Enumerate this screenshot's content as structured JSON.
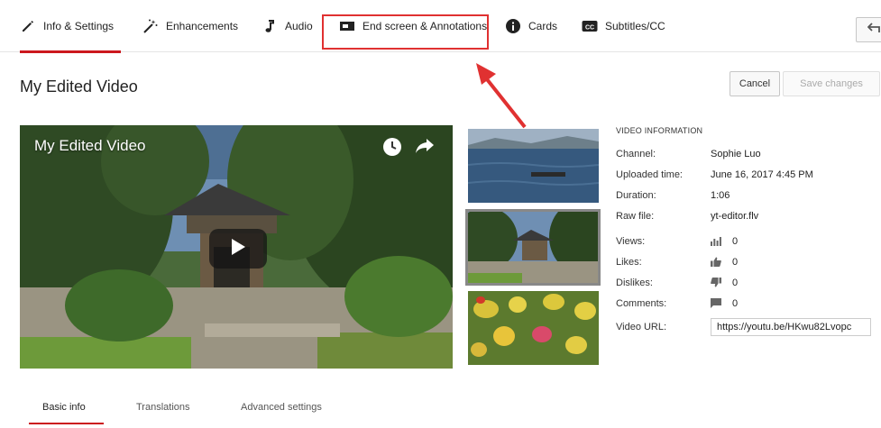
{
  "tabs": [
    {
      "label": "Info & Settings",
      "icon": "pencil-icon",
      "active": true
    },
    {
      "label": "Enhancements",
      "icon": "magic-wand-icon",
      "active": false
    },
    {
      "label": "Audio",
      "icon": "music-note-icon",
      "active": false
    },
    {
      "label": "End screen & Annotations",
      "icon": "end-screen-icon",
      "active": false
    },
    {
      "label": "Cards",
      "icon": "info-circle-icon",
      "active": false
    },
    {
      "label": "Subtitles/CC",
      "icon": "cc-icon",
      "active": false
    }
  ],
  "page": {
    "title": "My Edited Video"
  },
  "actions": {
    "cancel_label": "Cancel",
    "save_label": "Save changes"
  },
  "player": {
    "title": "My Edited Video"
  },
  "video_info": {
    "heading": "VIDEO INFORMATION",
    "channel_label": "Channel:",
    "channel": "Sophie Luo",
    "uploaded_label": "Uploaded time:",
    "uploaded": "June 16, 2017 4:45 PM",
    "duration_label": "Duration:",
    "duration": "1:06",
    "raw_label": "Raw file:",
    "raw": "yt-editor.flv",
    "views_label": "Views:",
    "views": "0",
    "likes_label": "Likes:",
    "likes": "0",
    "dislikes_label": "Dislikes:",
    "dislikes": "0",
    "comments_label": "Comments:",
    "comments": "0",
    "url_label": "Video URL:",
    "url": "https://youtu.be/HKwu82Lvopc"
  },
  "bottom_tabs": [
    {
      "label": "Basic info",
      "active": true
    },
    {
      "label": "Translations",
      "active": false
    },
    {
      "label": "Advanced settings",
      "active": false
    }
  ],
  "colors": {
    "accent": "#cc181e",
    "annotation": "#e03131"
  }
}
